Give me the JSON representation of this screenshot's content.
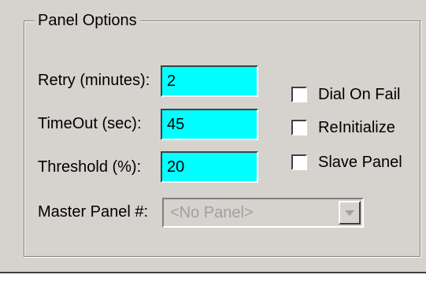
{
  "panel_options": {
    "title": "Panel Options",
    "retry": {
      "label": "Retry (minutes):",
      "value": "2"
    },
    "timeout": {
      "label": "TimeOut (sec):",
      "value": "45"
    },
    "threshold": {
      "label": "Threshold (%):",
      "value": "20"
    },
    "checkboxes": [
      {
        "label": "Dial On Fail",
        "checked": false
      },
      {
        "label": "ReInitialize",
        "checked": false
      },
      {
        "label": "Slave Panel",
        "checked": false
      }
    ],
    "master_panel": {
      "label": "Master Panel #:",
      "selected": "<No Panel>",
      "enabled": false
    }
  },
  "colors": {
    "field_background": "#00ffff",
    "window_background": "#d6d3ce",
    "disabled_text": "#a0a0a0"
  },
  "icons": {
    "dropdown": "chevron-down-icon"
  }
}
